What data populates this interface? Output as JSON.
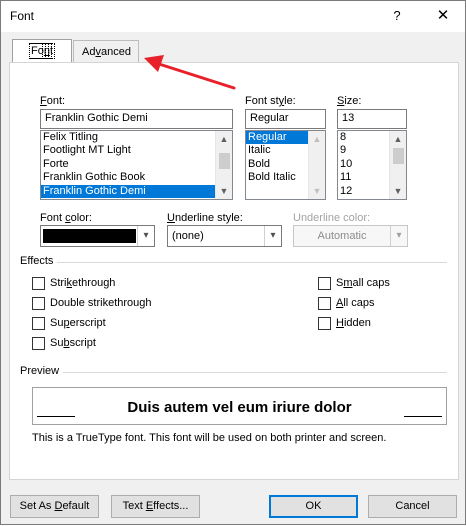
{
  "window": {
    "title": "Font",
    "help_label": "?",
    "close_label": "✕"
  },
  "tabs": [
    {
      "label": "Font",
      "underline": "n",
      "before": "Fo",
      "after": "t",
      "active": true
    },
    {
      "label": "Advanced",
      "before": "Ad",
      "underline": "v",
      "after": "anced",
      "active": false
    }
  ],
  "font": {
    "label_pre": "",
    "label_u": "F",
    "label_post": "ont:",
    "value": "Franklin Gothic Demi",
    "list": [
      "Felix Titling",
      "Footlight MT Light",
      "Forte",
      "Franklin Gothic Book",
      "Franklin Gothic Demi"
    ],
    "selected_index": 4
  },
  "style": {
    "label_pre": "Font st",
    "label_u": "y",
    "label_post": "le:",
    "value": "Regular",
    "list": [
      "Regular",
      "Italic",
      "Bold",
      "Bold Italic"
    ],
    "selected_index": 0
  },
  "size": {
    "label_pre": "",
    "label_u": "S",
    "label_post": "ize:",
    "value": "13",
    "list": [
      "8",
      "9",
      "10",
      "11",
      "12"
    ]
  },
  "font_color": {
    "label_pre": "Font ",
    "label_u": "c",
    "label_post": "olor:",
    "value": "#000000"
  },
  "underline_style": {
    "label_pre": "",
    "label_u": "U",
    "label_post": "nderline style:",
    "value": "(none)"
  },
  "underline_color": {
    "label": "Underline color:",
    "value": "Automatic"
  },
  "effects": {
    "title": "Effects",
    "left": [
      {
        "pre": "Stri",
        "u": "k",
        "post": "ethrough"
      },
      {
        "pre": "Double strikethrou",
        "u": "g",
        "post": "h"
      },
      {
        "pre": "Su",
        "u": "p",
        "post": "erscript"
      },
      {
        "pre": "Su",
        "u": "b",
        "post": "script"
      }
    ],
    "right": [
      {
        "pre": "S",
        "u": "m",
        "post": "all caps"
      },
      {
        "pre": "",
        "u": "A",
        "post": "ll caps"
      },
      {
        "pre": "",
        "u": "H",
        "post": "idden"
      }
    ]
  },
  "preview": {
    "title": "Preview",
    "sample": "Duis autem vel eum iriure dolor",
    "note": "This is a TrueType font. This font will be used on both printer and screen."
  },
  "buttons": {
    "set_default": {
      "pre": "Set As ",
      "u": "D",
      "post": "efault"
    },
    "text_effects": {
      "pre": "Text ",
      "u": "E",
      "post": "ffects..."
    },
    "ok": "OK",
    "cancel": "Cancel"
  },
  "annotation": {
    "color": "#e8202a"
  },
  "icons": {
    "dropdown": "▾",
    "scroll_up": "▲",
    "scroll_down": "▼"
  }
}
